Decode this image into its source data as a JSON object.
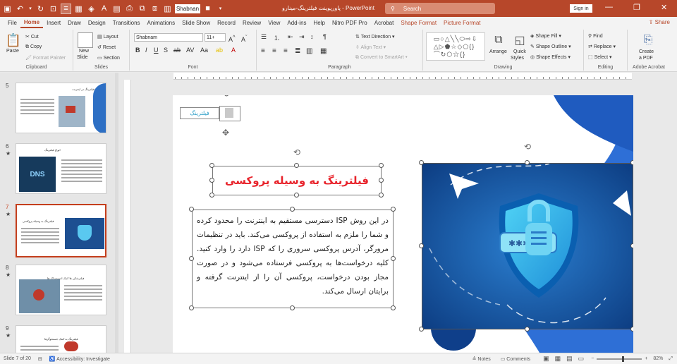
{
  "title_bar": {
    "doc_title": "پاورپوینت فیلترینگ-مینارو - PowerPoint",
    "search_placeholder": "Search",
    "signin": "Sign in",
    "font_name": "Shabnan",
    "accent": "#b7472a"
  },
  "tabs": [
    "File",
    "Home",
    "Insert",
    "Draw",
    "Design",
    "Transitions",
    "Animations",
    "Slide Show",
    "Record",
    "Review",
    "View",
    "Add-ins",
    "Help",
    "Nitro PDF Pro",
    "Acrobat",
    "Shape Format",
    "Picture Format"
  ],
  "share": "Share",
  "ribbon": {
    "clipboard": {
      "paste": "Paste",
      "cut": "Cut",
      "copy": "Copy",
      "format_painter": "Format Painter",
      "label": "Clipboard"
    },
    "slides": {
      "new_slide": "New",
      "new_slide2": "Slide",
      "layout": "Layout",
      "reset": "Reset",
      "section": "Section",
      "label": "Slides"
    },
    "font": {
      "font_name": "Shabnam",
      "font_size": "11+",
      "label": "Font"
    },
    "paragraph": {
      "text_direction": "Text Direction",
      "align_text": "Align Text",
      "smartart": "Convert to SmartArt",
      "label": "Paragraph"
    },
    "drawing": {
      "arrange": "Arrange",
      "quick_styles": "Quick",
      "quick_styles2": "Styles",
      "shape_fill": "Shape Fill",
      "shape_outline": "Shape Outline",
      "shape_effects": "Shape Effects",
      "label": "Drawing"
    },
    "editing": {
      "find": "Find",
      "replace": "Replace",
      "select": "Select",
      "label": "Editing"
    },
    "acrobat": {
      "create_pdf": "Create",
      "create_pdf2": "a PDF",
      "label": "Adobe Acrobat"
    }
  },
  "thumbnails": [
    {
      "num": "5",
      "title": "مثالی فیلترینگ در اینترنت"
    },
    {
      "num": "6",
      "title": "انواع فیلترینگ",
      "label": "DNS"
    },
    {
      "num": "7",
      "title": "فیلترینگ به وسیله پروکسی"
    },
    {
      "num": "8",
      "title": "فیلترشکن ها کمک اسپیدتراک ها"
    },
    {
      "num": "9",
      "title": "فیلترینگ به کمک جستجوگرها"
    }
  ],
  "slide": {
    "tag": "فیلترینگ",
    "heading": "فیلترینگ به وسیله پروکسی",
    "body": "در این روش ISP دسترسی مستقیم به اینترنت را محدود کرده و شما را ملزم به استفاده از پروکسی می‌کند. باید در تنظیمات مرورگر، آدرس پروکسی سروری را که ISP دارد را وارد کنید. کلیه درخواست‌ها به پروکسی فرستاده می‌شود و در صورت مجاز بودن درخواست، پروکسی آن را از اینترنت گرفته و برایتان ارسال می‌کند.",
    "heading_color": "#e8232b"
  },
  "status": {
    "slide_count": "Slide 7 of 20",
    "accessibility": "Accessibility: Investigate",
    "notes": "Notes",
    "comments": "Comments",
    "zoom": "82%"
  }
}
